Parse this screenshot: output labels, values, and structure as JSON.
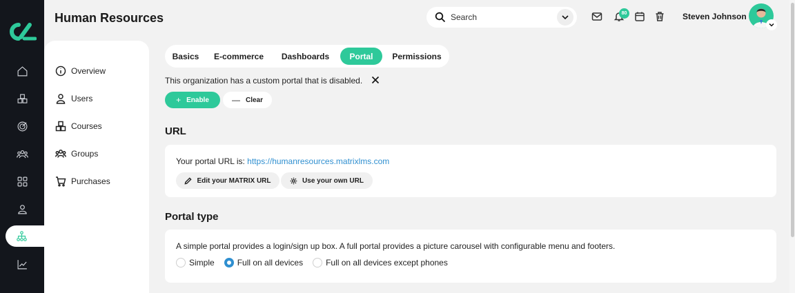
{
  "header": {
    "title": "Human Resources",
    "search_placeholder": "Search",
    "notification_count": "80",
    "user_name": "Steven Johnson"
  },
  "rail": {
    "items": [
      "home-icon",
      "cubes-icon",
      "target-icon",
      "team-icon",
      "grid-icon",
      "user-icon",
      "org-chart-icon",
      "chart-icon"
    ],
    "active": "org-chart-icon"
  },
  "subnav": {
    "items": [
      {
        "label": "Overview",
        "icon": "info-icon"
      },
      {
        "label": "Users",
        "icon": "user-icon"
      },
      {
        "label": "Courses",
        "icon": "cubes-icon"
      },
      {
        "label": "Groups",
        "icon": "group-icon"
      },
      {
        "label": "Purchases",
        "icon": "cart-icon"
      }
    ]
  },
  "tabs": {
    "items": [
      "Basics",
      "E-commerce",
      "Dashboards",
      "Portal",
      "Permissions"
    ],
    "active": "Portal"
  },
  "notice": {
    "text": "This organization has a custom portal that is disabled.",
    "enable_label": "Enable",
    "clear_label": "Clear"
  },
  "url_section": {
    "heading": "URL",
    "prefix": "Your portal URL is: ",
    "url": "https://humanresources.matrixlms.com",
    "edit_label": "Edit your MATRIX URL",
    "own_label": "Use your own URL"
  },
  "portal_type": {
    "heading": "Portal type",
    "description": "A simple portal provides a login/sign up box. A full portal provides a picture carousel with configurable menu and footers.",
    "options": [
      "Simple",
      "Full on all devices",
      "Full on all devices except phones"
    ],
    "selected": "Full on all devices"
  },
  "colors": {
    "accent": "#2ec99a",
    "rail": "#13161c",
    "link": "#2f8fd0"
  }
}
